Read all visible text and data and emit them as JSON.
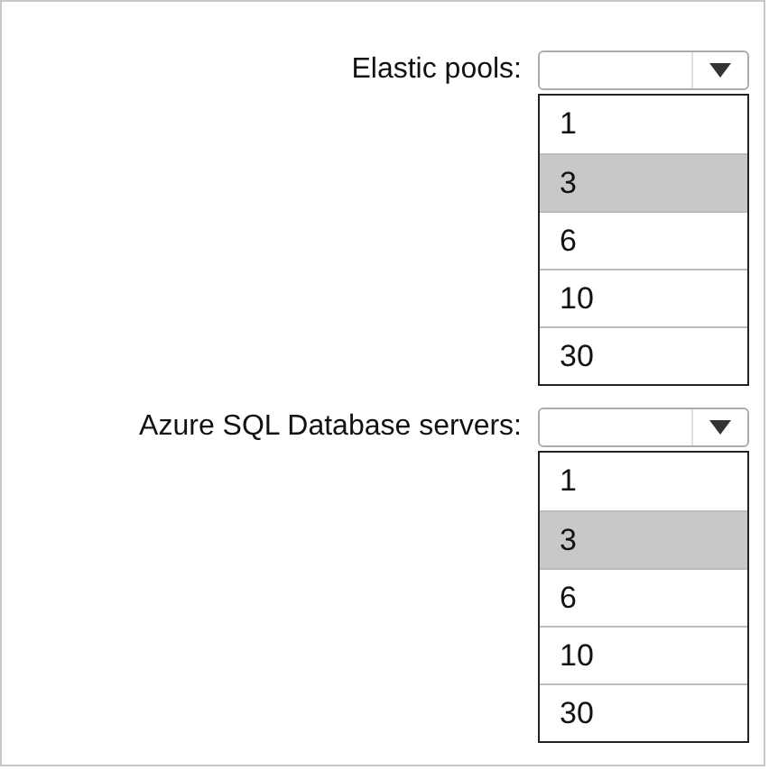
{
  "groups": [
    {
      "label": "Elastic pools:",
      "options": [
        {
          "text": "1",
          "selected": false
        },
        {
          "text": "3",
          "selected": true
        },
        {
          "text": "6",
          "selected": false
        },
        {
          "text": "10",
          "selected": false
        },
        {
          "text": "30",
          "selected": false
        }
      ]
    },
    {
      "label": "Azure SQL Database servers:",
      "options": [
        {
          "text": "1",
          "selected": false
        },
        {
          "text": "3",
          "selected": true
        },
        {
          "text": "6",
          "selected": false
        },
        {
          "text": "10",
          "selected": false
        },
        {
          "text": "30",
          "selected": false
        }
      ]
    }
  ]
}
